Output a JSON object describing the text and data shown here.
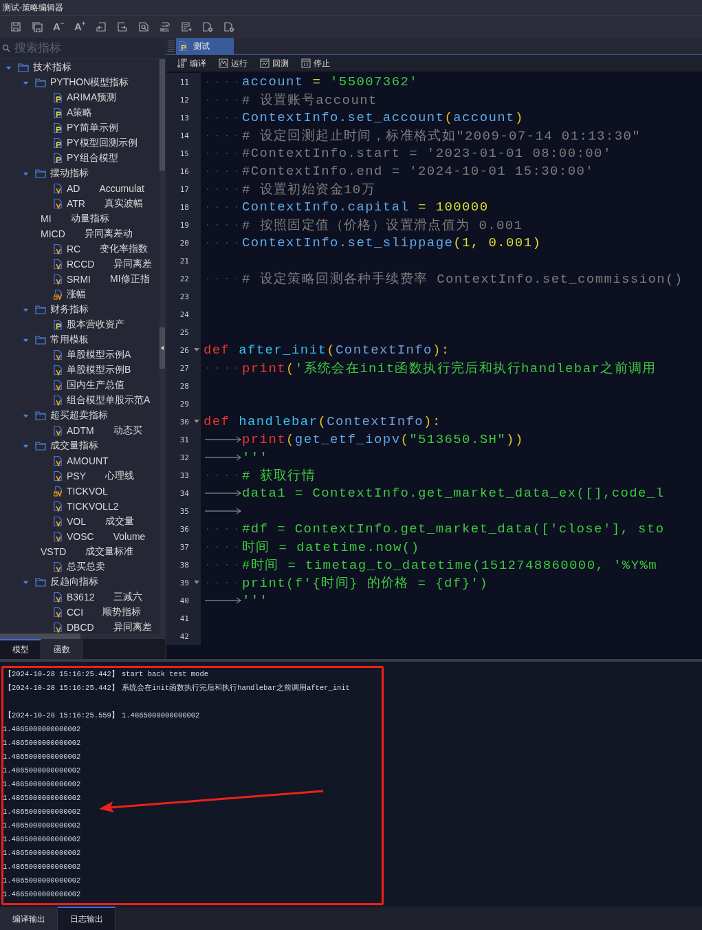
{
  "window": {
    "title": "测试-策略编辑器"
  },
  "toolbar": [
    {
      "kind": "save"
    },
    {
      "kind": "save-all"
    },
    {
      "kind": "font-smaller",
      "glyph": "A"
    },
    {
      "kind": "font-larger",
      "glyph": "A"
    },
    {
      "kind": "undo"
    },
    {
      "kind": "redo"
    },
    {
      "kind": "find"
    },
    {
      "kind": "replace"
    },
    {
      "kind": "export"
    },
    {
      "kind": "doc-settings"
    },
    {
      "kind": "doc-settings"
    }
  ],
  "sidebar": {
    "search": {
      "placeholder": "搜索指标"
    },
    "tree": [
      {
        "kind": "folder",
        "label": "技术指标",
        "expanded": true,
        "children": [
          {
            "kind": "folder",
            "label": "PYTHON模型指标",
            "expanded": true,
            "children": [
              {
                "kind": "python",
                "name": "ARIMA预测"
              },
              {
                "kind": "python",
                "name": "A策略"
              },
              {
                "kind": "python",
                "name": "PY简单示例"
              },
              {
                "kind": "python",
                "name": "PY模型回测示例"
              },
              {
                "kind": "python",
                "name": "PY组合模型"
              }
            ]
          },
          {
            "kind": "folder",
            "label": "摆动指标",
            "expanded": true,
            "children": [
              {
                "kind": "formula",
                "name": "AD",
                "description": "Accumulat"
              },
              {
                "kind": "formula",
                "name": "ATR",
                "description": "真实波幅"
              },
              {
                "kind": "plain",
                "name": "MI",
                "description": "动量指标"
              },
              {
                "kind": "plain",
                "name": "MICD",
                "description": "异同离差动"
              },
              {
                "kind": "formula",
                "name": "RC",
                "description": "变化率指数"
              },
              {
                "kind": "formula",
                "name": "RCCD",
                "description": "异同离差"
              },
              {
                "kind": "formula",
                "name": "SRMI",
                "description": "MI修正指"
              },
              {
                "kind": "locked",
                "name": "涨幅"
              }
            ]
          },
          {
            "kind": "folder",
            "label": "财务指标",
            "expanded": true,
            "children": [
              {
                "kind": "python",
                "name": "股本营收资产"
              }
            ]
          },
          {
            "kind": "folder",
            "label": "常用模板",
            "expanded": true,
            "children": [
              {
                "kind": "formula",
                "name": "单股模型示例A"
              },
              {
                "kind": "formula",
                "name": "单股模型示例B"
              },
              {
                "kind": "formula",
                "name": "国内生产总值"
              },
              {
                "kind": "formula",
                "name": "组合模型单股示范A"
              }
            ]
          },
          {
            "kind": "folder",
            "label": "超买超卖指标",
            "expanded": true,
            "children": [
              {
                "kind": "formula",
                "name": "ADTM",
                "description": "动态买"
              }
            ]
          },
          {
            "kind": "folder",
            "label": "成交量指标",
            "expanded": true,
            "children": [
              {
                "kind": "formula",
                "name": "AMOUNT"
              },
              {
                "kind": "formula",
                "name": "PSY",
                "description": "心理线"
              },
              {
                "kind": "locked",
                "name": "TICKVOL"
              },
              {
                "kind": "formula",
                "name": "TICKVOLL2"
              },
              {
                "kind": "formula",
                "name": "VOL",
                "description": "成交量"
              },
              {
                "kind": "formula",
                "name": "VOSC",
                "description": "Volume"
              },
              {
                "kind": "plain",
                "name": "VSTD",
                "description": "成交量标准"
              },
              {
                "kind": "formula",
                "name": "总买总卖"
              }
            ]
          },
          {
            "kind": "folder",
            "label": "反趋向指标",
            "expanded": true,
            "children": [
              {
                "kind": "formula",
                "name": "B3612",
                "description": "三减六"
              },
              {
                "kind": "formula",
                "name": "CCI",
                "description": "顺势指标"
              },
              {
                "kind": "formula",
                "name": "DBCD",
                "description": "异同离差"
              }
            ]
          }
        ]
      }
    ],
    "tabs": [
      {
        "label": "模型",
        "selected": true
      },
      {
        "label": "函数",
        "selected": false
      }
    ]
  },
  "editor": {
    "tabs": [
      {
        "label": "测试",
        "selected": true
      }
    ],
    "actions": [
      {
        "kind": "compile",
        "label": "编译"
      },
      {
        "kind": "run",
        "label": "运行"
      },
      {
        "kind": "backtest",
        "label": "回测"
      },
      {
        "kind": "stop",
        "label": "停止"
      }
    ],
    "lines": [
      {
        "number": "11",
        "kind": "dotted",
        "tokens": [
          {
            "kind": "ident",
            "text": "account"
          },
          {
            "kind": "op",
            "text": " = "
          },
          {
            "kind": "str",
            "text": "'55007362'"
          }
        ]
      },
      {
        "number": "12",
        "kind": "dotted",
        "tokens": [
          {
            "kind": "cmt",
            "text": "# 设置账号account"
          }
        ]
      },
      {
        "number": "13",
        "kind": "dotted",
        "tokens": [
          {
            "kind": "ident",
            "text": "ContextInfo.set_account"
          },
          {
            "kind": "paren",
            "text": "("
          },
          {
            "kind": "ident",
            "text": "account"
          },
          {
            "kind": "paren",
            "text": ")"
          }
        ]
      },
      {
        "number": "14",
        "kind": "dotted",
        "tokens": [
          {
            "kind": "cmt",
            "text": "# 设定回测起止时间，标准格式如\"2009-07-14 01:13:30\""
          }
        ]
      },
      {
        "number": "15",
        "kind": "dotted",
        "tokens": [
          {
            "kind": "cmt",
            "text": "#ContextInfo.start = '2023-01-01 08:00:00'"
          }
        ]
      },
      {
        "number": "16",
        "kind": "dotted",
        "tokens": [
          {
            "kind": "cmt",
            "text": "#ContextInfo.end = '2024-10-01 15:30:00'"
          }
        ]
      },
      {
        "number": "17",
        "kind": "dotted",
        "tokens": [
          {
            "kind": "cmt",
            "text": "# 设置初始资金10万"
          }
        ]
      },
      {
        "number": "18",
        "kind": "dotted",
        "tokens": [
          {
            "kind": "ident",
            "text": "ContextInfo.capital"
          },
          {
            "kind": "op",
            "text": " = "
          },
          {
            "kind": "num",
            "text": "100000"
          }
        ]
      },
      {
        "number": "19",
        "kind": "dotted",
        "tokens": [
          {
            "kind": "cmt",
            "text": "# 按照固定值（价格）设置滑点值为 0.001"
          }
        ]
      },
      {
        "number": "20",
        "kind": "dotted",
        "tokens": [
          {
            "kind": "ident",
            "text": "ContextInfo.set_slippage"
          },
          {
            "kind": "num",
            "text": "(1, 0.001)"
          }
        ]
      },
      {
        "number": "21"
      },
      {
        "number": "22",
        "kind": "dotted",
        "tokens": [
          {
            "kind": "cmt",
            "text": "# 设定策略回测各种手续费率 ContextInfo.set_commission()"
          }
        ]
      },
      {
        "number": "23"
      },
      {
        "number": "24"
      },
      {
        "number": "25"
      },
      {
        "number": "26",
        "fold": true,
        "tokens": [
          {
            "kind": "kw",
            "text": "def "
          },
          {
            "kind": "fn",
            "text": "after_init"
          },
          {
            "kind": "paren",
            "text": "("
          },
          {
            "kind": "cls",
            "text": "ContextInfo"
          },
          {
            "kind": "paren",
            "text": "):"
          }
        ]
      },
      {
        "number": "27",
        "kind": "dotted",
        "tokens": [
          {
            "kind": "kw",
            "text": "print"
          },
          {
            "kind": "paren",
            "text": "("
          },
          {
            "kind": "str",
            "text": "'系统会在init函数执行完后和执行handlebar之前调用"
          }
        ]
      },
      {
        "number": "28"
      },
      {
        "number": "29"
      },
      {
        "number": "30",
        "fold": true,
        "tokens": [
          {
            "kind": "kw",
            "text": "def "
          },
          {
            "kind": "fn",
            "text": "handlebar"
          },
          {
            "kind": "paren",
            "text": "("
          },
          {
            "kind": "cls",
            "text": "ContextInfo"
          },
          {
            "kind": "paren",
            "text": "):"
          }
        ]
      },
      {
        "number": "31",
        "kind": "tabbed",
        "tokens": [
          {
            "kind": "kw",
            "text": "print"
          },
          {
            "kind": "paren",
            "text": "("
          },
          {
            "kind": "ident",
            "text": "get_etf_iopv"
          },
          {
            "kind": "paren",
            "text": "("
          },
          {
            "kind": "str",
            "text": "\"513650.SH\""
          },
          {
            "kind": "paren",
            "text": "))"
          }
        ]
      },
      {
        "number": "32",
        "kind": "tabbed",
        "tokens": [
          {
            "kind": "str",
            "text": "'''"
          }
        ]
      },
      {
        "number": "33",
        "kind": "dotted",
        "tokens": [
          {
            "kind": "str",
            "text": "# 获取行情"
          }
        ]
      },
      {
        "number": "34",
        "kind": "tabbed",
        "tokens": [
          {
            "kind": "str",
            "text": "data1 = ContextInfo.get_market_data_ex([],code_l"
          }
        ]
      },
      {
        "number": "35",
        "kind": "tabbed"
      },
      {
        "number": "36",
        "kind": "dotted",
        "tokens": [
          {
            "kind": "str",
            "text": "#df = ContextInfo.get_market_data(['close'], sto"
          }
        ]
      },
      {
        "number": "37",
        "kind": "dotted",
        "tokens": [
          {
            "kind": "str",
            "text": "时间 = datetime.now()"
          }
        ]
      },
      {
        "number": "38",
        "kind": "dotted",
        "tokens": [
          {
            "kind": "str",
            "text": "#时间 = timetag_to_datetime(1512748860000, '%Y%m"
          }
        ]
      },
      {
        "number": "39",
        "kind": "dotted",
        "fold": true,
        "tokens": [
          {
            "kind": "str",
            "text": "print(f'{时间} 的价格 = {df}')"
          }
        ]
      },
      {
        "number": "40",
        "kind": "tabbed",
        "tokens": [
          {
            "kind": "str",
            "text": "'''"
          }
        ]
      },
      {
        "number": "41"
      },
      {
        "number": "42"
      }
    ]
  },
  "output": {
    "lines": [
      {
        "kind": "stamped",
        "timestamp": "【2024-10-28 15:16:25.442】",
        "text": "start back test mode"
      },
      {
        "kind": "stamped",
        "timestamp": "【2024-10-28 15:16:25.442】",
        "text": "系统会在init函数执行完后和执行handlebar之前调用after_init"
      },
      {
        "kind": "blank"
      },
      {
        "kind": "stamped",
        "timestamp": "【2024-10-28 15:16:25.559】",
        "text": "1.4865000000000002"
      },
      {
        "kind": "plain",
        "text": "1.4865000000000002"
      },
      {
        "kind": "plain",
        "text": "1.4865000000000002"
      },
      {
        "kind": "plain",
        "text": "1.4865000000000002"
      },
      {
        "kind": "plain",
        "text": "1.4865000000000002"
      },
      {
        "kind": "plain",
        "text": "1.4865000000000002"
      },
      {
        "kind": "plain",
        "text": "1.4865000000000002"
      },
      {
        "kind": "plain",
        "text": "1.4865000000000002"
      },
      {
        "kind": "plain",
        "text": "1.4865000000000002"
      },
      {
        "kind": "plain",
        "text": "1.4865000000000002"
      },
      {
        "kind": "plain",
        "text": "1.4865000000000002"
      },
      {
        "kind": "plain",
        "text": "1.4865000000000002"
      },
      {
        "kind": "plain",
        "text": "1.4865000000000002"
      },
      {
        "kind": "plain",
        "text": "1.4865000000000002"
      }
    ],
    "annotations": {
      "highlight_box": true,
      "arrow": true
    },
    "tabs": [
      {
        "label": "编译输出",
        "selected": false
      },
      {
        "label": "日志输出",
        "selected": true
      }
    ]
  }
}
